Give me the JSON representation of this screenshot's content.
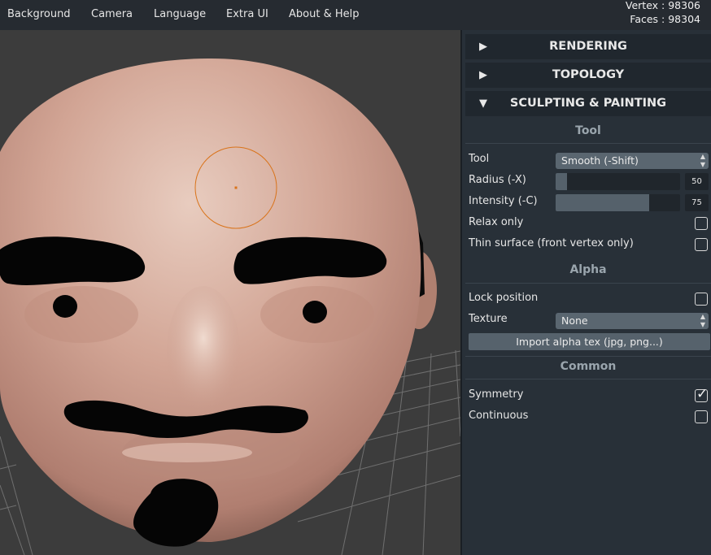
{
  "menu": [
    "Background",
    "Camera",
    "Language",
    "Extra UI",
    "About & Help"
  ],
  "stats": {
    "vertex": "Vertex : 98306",
    "faces": "Faces : 98304"
  },
  "panel": {
    "rendering": {
      "arrow": "▶",
      "label": "RENDERING"
    },
    "topology": {
      "arrow": "▶",
      "label": "TOPOLOGY"
    },
    "sculpting": {
      "arrow": "▼",
      "label": "SCULPTING & PAINTING"
    },
    "tool_section": "Tool",
    "tool_label": "Tool",
    "tool_value": "Smooth (-Shift)",
    "radius_label": "Radius (-X)",
    "radius_value": "50",
    "radius_fraction": 0.09,
    "intensity_label": "Intensity (-C)",
    "intensity_value": "75",
    "intensity_fraction": 0.75,
    "relax_label": "Relax only",
    "relax_checked": false,
    "thin_label": "Thin surface (front vertex only)",
    "thin_checked": false,
    "alpha_section": "Alpha",
    "lock_label": "Lock position",
    "lock_checked": false,
    "texture_label": "Texture",
    "texture_value": "None",
    "import_button": "Import alpha tex (jpg, png...)",
    "common_section": "Common",
    "symmetry_label": "Symmetry",
    "symmetry_checked": true,
    "continuous_label": "Continuous",
    "continuous_checked": false
  },
  "icons": {
    "select_arrows": "▲▼",
    "check_mark": "✓"
  },
  "colors": {
    "brush_ring": "#d9731a",
    "skin": "#d4a898",
    "panel_bg": "#283038",
    "topbar_bg": "#262b31"
  }
}
